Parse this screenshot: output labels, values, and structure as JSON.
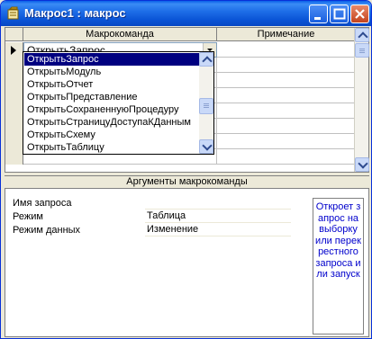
{
  "window": {
    "title": "Макрос1 : макрос"
  },
  "grid": {
    "headers": {
      "command": "Макрокоманда",
      "note": "Примечание"
    },
    "current_value": "ОткрытьЗапрос"
  },
  "dropdown": {
    "items": [
      "ОткрытьЗапрос",
      "ОткрытьМодуль",
      "ОткрытьОтчет",
      "ОткрытьПредставление",
      "ОткрытьСохраненнуюПроцедуру",
      "ОткрытьСтраницуДоступаКДанным",
      "ОткрытьСхему",
      "ОткрытьТаблицу"
    ],
    "selected_index": 0
  },
  "args": {
    "title": "Аргументы макрокоманды",
    "rows": [
      {
        "label": "Имя запроса",
        "value": ""
      },
      {
        "label": "Режим",
        "value": "Таблица"
      },
      {
        "label": "Режим данных",
        "value": "Изменение"
      }
    ],
    "help_text": "Откроет запрос на выборку или перекрестного запроса или запуск"
  }
}
